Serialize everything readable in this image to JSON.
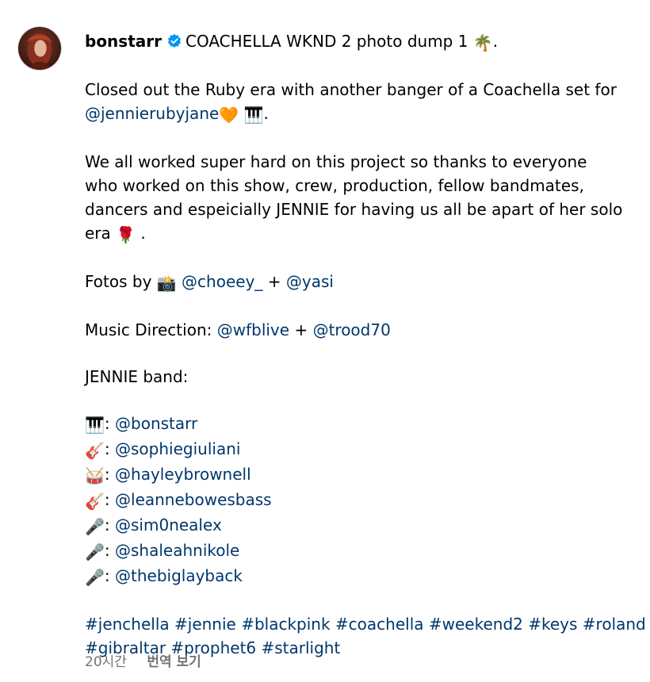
{
  "post": {
    "username": "bonstarr",
    "title": "COACHELLA WKND 2 photo dump 1",
    "title_emoji": "🌴",
    "title_end": ".",
    "p1_line1": "Closed out the Ruby era with another banger of a Coachella set for",
    "p1_mention": "@jennierubyjane",
    "p1_heart": "🧡",
    "p1_keys": "🎹",
    "p1_end": ".",
    "p2_line1": "We all worked super hard on this project so thanks to everyone",
    "p2_line2": "who worked on this show, crew, production, fellow bandmates,",
    "p2_line3": "dancers and espeicially JENNIE for having us all be apart of her solo",
    "p2_line4": "era",
    "p2_rose": "🌹",
    "p2_end": ".",
    "fotos_label": "Fotos by",
    "fotos_camera": "📸",
    "fotos_mention1": "@choeey_",
    "plus": "+",
    "fotos_mention2": "@yasi",
    "music_label": "Music Direction:",
    "music_mention1": "@wfblive",
    "music_mention2": "@trood70",
    "band_label": "JENNIE band:",
    "band": [
      {
        "emoji": "🎹",
        "handle": "@bonstarr"
      },
      {
        "emoji": "🎸",
        "handle": "@sophiegiuliani"
      },
      {
        "emoji": "🥁",
        "handle": "@hayleybrownell"
      },
      {
        "emoji": "🎸",
        "handle": "@leannebowesbass"
      },
      {
        "emoji": "🎤",
        "handle": "@sim0nealex"
      },
      {
        "emoji": "🎤",
        "handle": "@shaleahnikole"
      },
      {
        "emoji": "🎤",
        "handle": "@thebiglayback"
      }
    ],
    "colon": ":",
    "hashtags": [
      "#jenchella",
      "#jennie",
      "#blackpink",
      "#coachella",
      "#weekend2",
      "#keys",
      "#roland",
      "#gibraltar",
      "#prophet6",
      "#starlight"
    ]
  },
  "footer": {
    "time": "20시간",
    "translate": "번역 보기"
  },
  "colors": {
    "link": "#00376b",
    "verified": "#0095f6",
    "muted": "#737373"
  },
  "icons": {
    "verified": "verified-badge-icon"
  }
}
